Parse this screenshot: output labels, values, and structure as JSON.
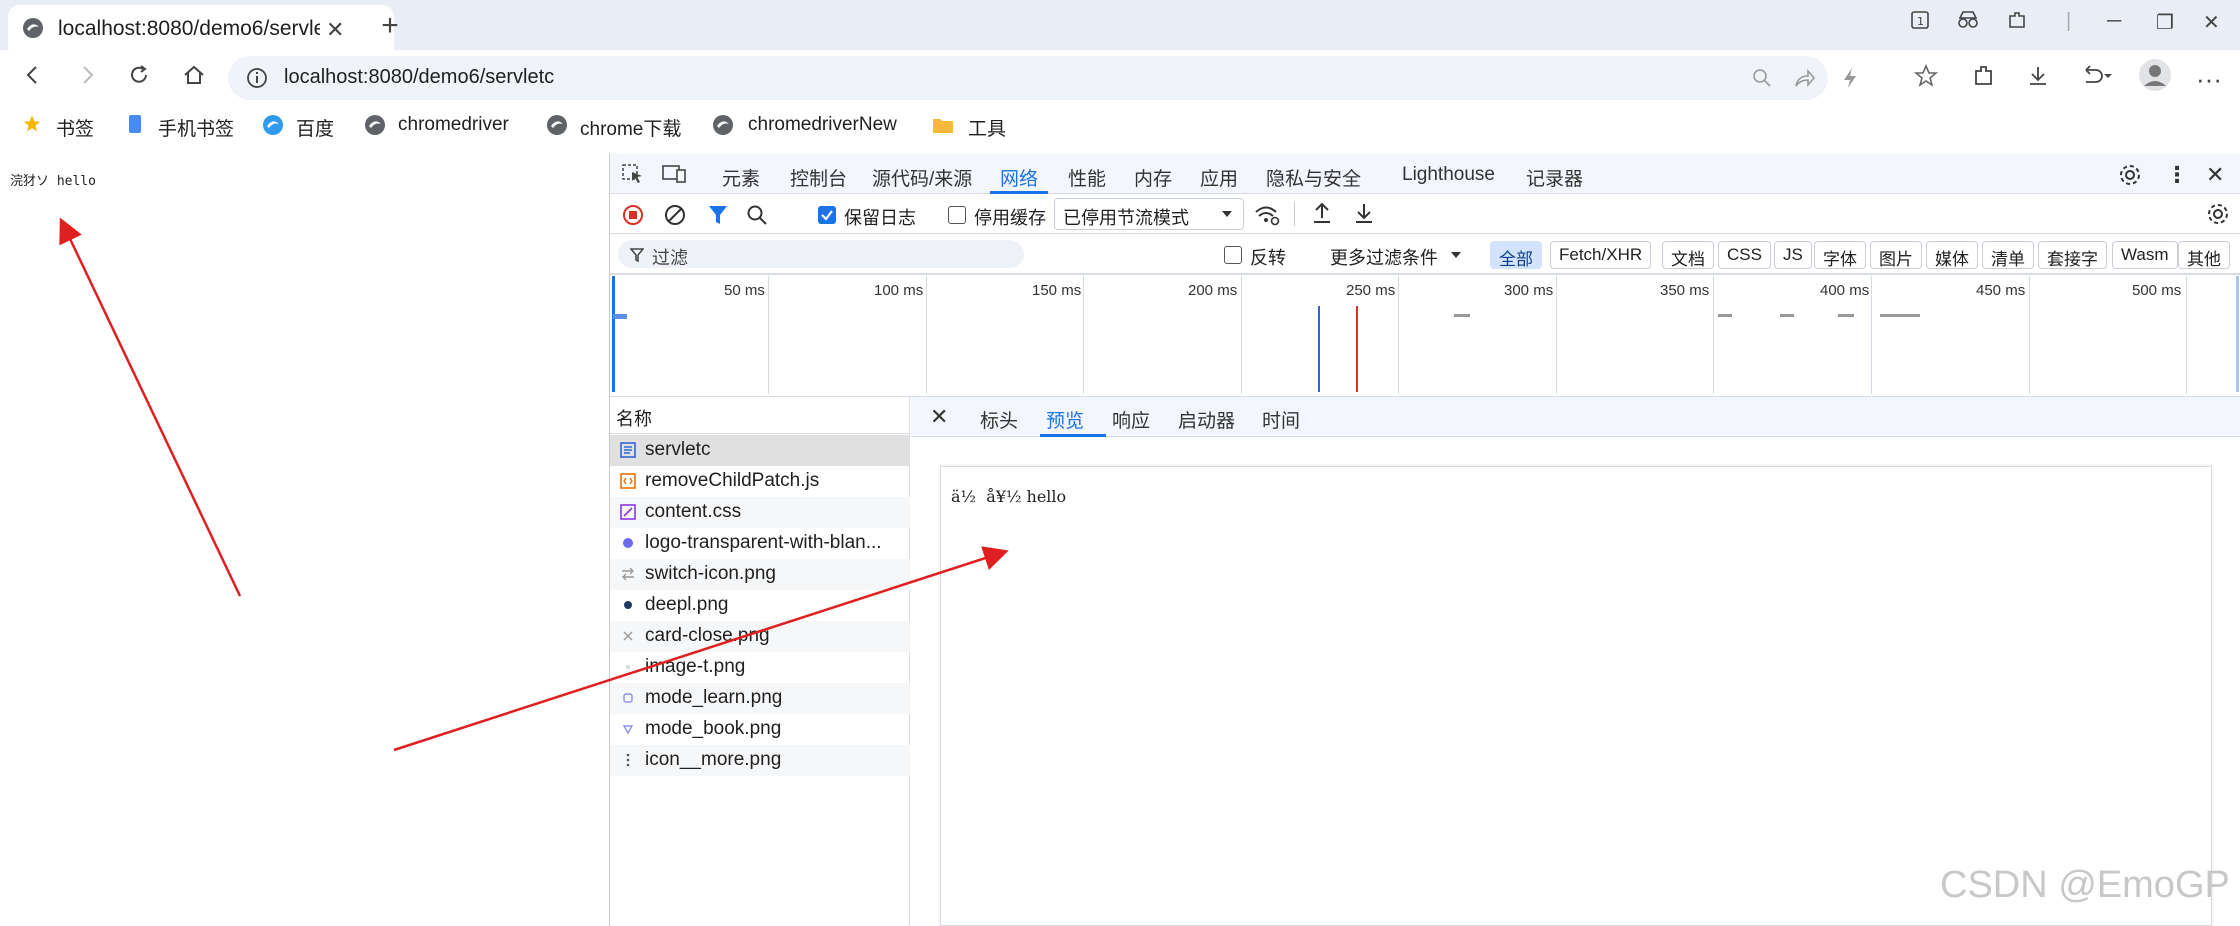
{
  "browser": {
    "tab_title": "localhost:8080/demo6/servle",
    "url": "localhost:8080/demo6/servletc",
    "new_tab": "+"
  },
  "bookmarks": [
    {
      "label": "书签",
      "icon": "star-icon"
    },
    {
      "label": "手机书签",
      "icon": "phone-icon"
    },
    {
      "label": "百度",
      "icon": "baidu-icon"
    },
    {
      "label": "chromedriver",
      "icon": "edge-icon"
    },
    {
      "label": "chrome下载",
      "icon": "edge-icon"
    },
    {
      "label": "chromedriverNew",
      "icon": "edge-icon"
    },
    {
      "label": "工具",
      "icon": "folder-icon"
    }
  ],
  "page": {
    "text": "浣犲ソ hello"
  },
  "devtools": {
    "tabs": [
      "元素",
      "控制台",
      "源代码/来源",
      "网络",
      "性能",
      "内存",
      "应用",
      "隐私与安全",
      "Lighthouse",
      "记录器"
    ],
    "active_tab": "网络",
    "toolbar": {
      "preserve_log": "保留日志",
      "disable_cache": "停用缓存",
      "throttle": "已停用节流模式"
    },
    "filter": {
      "placeholder": "过滤",
      "invert": "反转",
      "more_filters": "更多过滤条件",
      "types": [
        "全部",
        "Fetch/XHR",
        "文档",
        "CSS",
        "JS",
        "字体",
        "图片",
        "媒体",
        "清单",
        "套接字",
        "Wasm",
        "其他"
      ]
    },
    "timeline_ticks": [
      "50 ms",
      "100 ms",
      "150 ms",
      "200 ms",
      "250 ms",
      "300 ms",
      "350 ms",
      "400 ms",
      "450 ms",
      "500 ms"
    ],
    "requests_header": "名称",
    "requests": [
      "servletc",
      "removeChildPatch.js",
      "content.css",
      "logo-transparent-with-blan...",
      "switch-icon.png",
      "deepl.png",
      "card-close.png",
      "image-t.png",
      "mode_learn.png",
      "mode_book.png",
      "icon__more.png"
    ],
    "panel_tabs": [
      "标头",
      "预览",
      "响应",
      "启动器",
      "时间"
    ],
    "active_panel_tab": "预览",
    "preview_text": "ä½  å¥½ hello"
  },
  "watermark": "CSDN @EmoGP",
  "colors": {
    "accent": "#1a73e8",
    "arrow": "#e02020",
    "titlebar": "#e9eef6"
  }
}
